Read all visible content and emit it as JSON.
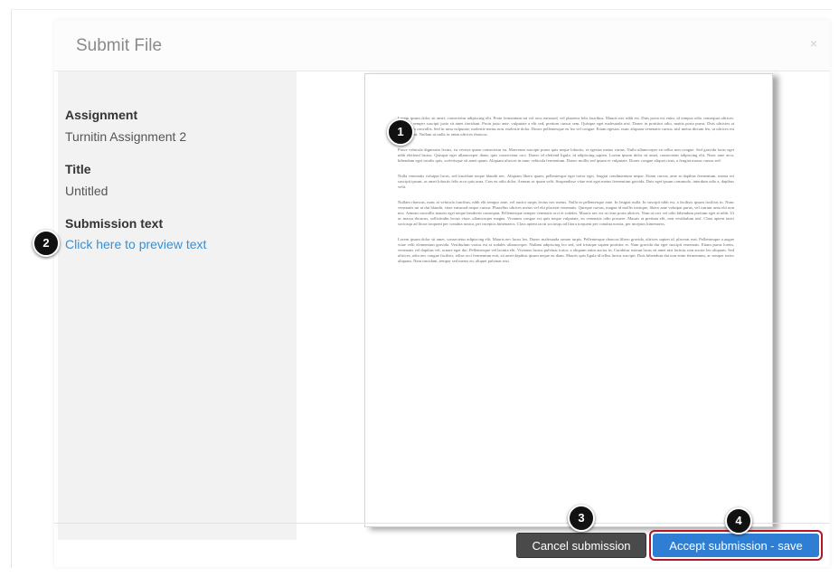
{
  "dialog": {
    "title": "Submit File",
    "close_glyph": "×"
  },
  "sidebar": {
    "assignment_label": "Assignment",
    "assignment_value": "Turnitin Assignment 2",
    "title_label": "Title",
    "title_value": "Untitled",
    "submission_label": "Submission text",
    "preview_link": "Click here to preview text"
  },
  "document": {
    "paragraphs": [
      "Lorem ipsum dolor sit amet, consectetur adipiscing elit. Proin fermentum mi vel arcu euismod, vel pharetra felis faucibus. Mauris nec nibh est. Duis porta est enim, id tempus odio consequat ultrices. Quisque semper suscipit justo sit amet tincidunt. Proin justo ante, vulputate a elit sed, pretium cursus sem. Quisque eget malesuada nisi. Donec in porttitor odio, mattis porta purus. Duis ultricies at neque quis convallis. Sed in urna vulputate, molestie metus non, molestie dolor. Donec pellentesque eu leo vel congue. Etiam egestas, nunc aliquam venenatis cursus, nisl metus dictum leo, ut ultrices est lorem in mi. Nullam ut nulla ac enim ultrices rhoncus.",
      "Fusce vehicula dignissim lectus, eu viverra quam consectetur eu. Maecenas suscipit purus quis neque lobortis, et egestas metus varius. Nulla ullamcorper eu tellus non congue. Sed gravida lacus eget nibh eleifend luctus. Quisque eget ullamcorper diam, quis consectetur orci. Donec id eleifend ligula, id adipiscing sapien. Lorem ipsum dolor sit amet, consectetur adipiscing elit. Nunc ante arcu, bibendum eget iaculis quis, scelerisque sit amet quam. Aliquam ultrices in nunc vehicula fermentum. Donec mollis sed ipsum et vulputate. Donec congue aliquet risus, a feugiat massa cursus sed.",
      "Nulla venenatis volutpat lacus, sed tincidunt neque blandit nec. Aliquam libero quam, pellentesque eget tortor eget, feugiat condimentum neque. Etiam cursus, ante at dapibus fermentum, massa est suscipit ipsum, ac amet lobortis felis arcu quis urna. Cras eu odio dolor. Aenean ac quam velit. Suspendisse vitae erat eget metus fermentum gravida. Duis eget ipsum commodo, interdum odio a, dapibus velit.",
      "Nullam rhoncus, nunc at vehicula faucibus, nibh elit tempor ante, vel auctor turpis lectus nec metus. Nulla in pellentesque ante. In feugiat nulla. In suscipit nibh est, a facilisis ipsum facilisis in. Nunc venenatis mi ut dui blandit, vitae euismod neque cursus. Phasellus ultrices metus vel elit placerat venenatis. Quisque cursus, magna id mollis tristique, libero ante volutpat purus, vel rutrum urna elit non nisi. Aenean convallis mauris eget neque hendrerit consequat. Pellentesque semper venenatis orci et sodales. Mauris nec est ut risus porta ultrices. Nam ut orci vel odio bibendum pretium eget at nibh. Ut ac massa rhoncus, sollicitudin lectus vitae, ullamcorper magna. Vivamus congue est quis neque vulputate, eu venenatis odio posuere. Mauris at pretium elit, non vestibulum nisl. Class aptent taciti sociosqu ad litora torquent per conubia nostra, per inceptos himenaeos. Class aptent taciti sociosqu ad litora torquent per conubia nostra, per inceptos himenaeos.",
      "Lorem ipsum dolor sit amet, consectetur adipiscing elit. Mauris nec lacus leo. Donec malesuada ornare turpis. Pellentesque rhoncus libero gravida, ultrices sapien id, placerat erat. Pellentesque a augue vitae velit elementum gravida. Vestibulum varius est at sodales ullamcorper. Nullam adipiscing leo sed, sed tristique sapien porttitor et. Nam gravida dui eget suscipit venenatis. Etiam purus lorem, venenatis vel dapibus vel, ornare eget dui. Pellentesque vel lacinia elit. Vivamus luctus pulvinar tortor, a aliquam enim auctor in. Curabitur rutrum lacus sit amet nisi lacinia, non auctor leo aliquam. Sed ultrices, odio nec congue facilisis, tellus orci fermentum erat, sit amet dapibus ipsum neque eu diam. Mauris quis ligula id tellus luctus suscipit. Duis bibendum dui non enim fermentum, ac semper tortor aliquam. Nam tincidunt, tempor sed metus eu, aliquet pulvinar nisi."
    ]
  },
  "footer": {
    "cancel_label": "Cancel submission",
    "accept_label": "Accept submission - save"
  },
  "callouts": {
    "c1": "1",
    "c2": "2",
    "c3": "3",
    "c4": "4"
  },
  "colors": {
    "accent": "#2e7fd4",
    "link": "#3a8fd0",
    "highlight_border": "#b0182a",
    "cancel_bg": "#4a4a4a"
  }
}
